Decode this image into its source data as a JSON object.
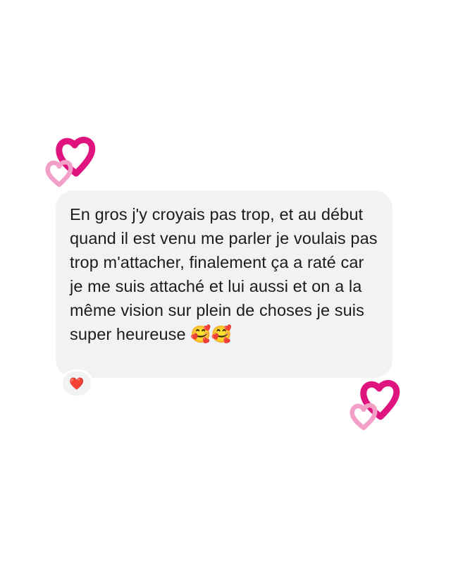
{
  "message": {
    "text": "En gros j'y croyais pas trop, et au début quand il est venu me parler je voulais pas trop m'attacher, finalement ça a raté car je me suis attaché et lui aussi et on a la même vision sur plein de choses je suis super heureuse 🥰🥰"
  },
  "reaction": {
    "emoji": "❤️"
  },
  "decorations": {
    "icon": "double-heart-outline-icon",
    "colors": {
      "heart_dark": "#e0147e",
      "heart_light": "#f3a0c8"
    }
  },
  "colors": {
    "background": "#ffffff",
    "bubble": "#f1f2f4",
    "text": "#1c1c1e"
  }
}
